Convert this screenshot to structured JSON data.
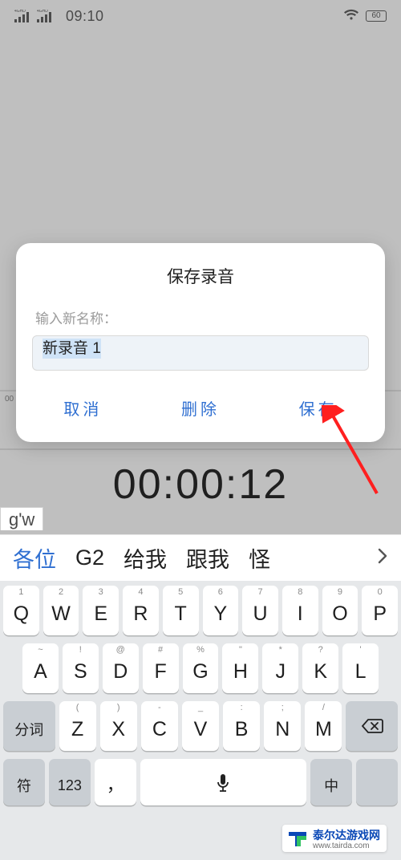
{
  "status_bar": {
    "sim1": "4GHD",
    "sim2": "4GHD",
    "time": "09:10",
    "battery": "60"
  },
  "recorder": {
    "elapsed": "00:00:12",
    "timeline_marker": "00"
  },
  "modal": {
    "title": "保存录音",
    "input_label": "输入新名称：",
    "input_value": "新录音 1",
    "actions": {
      "cancel": "取消",
      "delete": "删除",
      "save": "保存"
    }
  },
  "ime": {
    "composition": "g'w",
    "candidates": [
      "各位",
      "G2",
      "给我",
      "跟我",
      "怪"
    ]
  },
  "keyboard": {
    "row1": [
      {
        "sup": "1",
        "main": "Q"
      },
      {
        "sup": "2",
        "main": "W"
      },
      {
        "sup": "3",
        "main": "E"
      },
      {
        "sup": "4",
        "main": "R"
      },
      {
        "sup": "5",
        "main": "T"
      },
      {
        "sup": "6",
        "main": "Y"
      },
      {
        "sup": "7",
        "main": "U"
      },
      {
        "sup": "8",
        "main": "I"
      },
      {
        "sup": "9",
        "main": "O"
      },
      {
        "sup": "0",
        "main": "P"
      }
    ],
    "row2": [
      {
        "sup": "~",
        "main": "A"
      },
      {
        "sup": "!",
        "main": "S"
      },
      {
        "sup": "@",
        "main": "D"
      },
      {
        "sup": "#",
        "main": "F"
      },
      {
        "sup": "%",
        "main": "G"
      },
      {
        "sup": "\"",
        "main": "H"
      },
      {
        "sup": "*",
        "main": "J"
      },
      {
        "sup": "?",
        "main": "K"
      },
      {
        "sup": "'",
        "main": "L"
      }
    ],
    "row3_fn_left": "分词",
    "row3": [
      {
        "sup": "(",
        "main": "Z"
      },
      {
        "sup": ")",
        "main": "X"
      },
      {
        "sup": "-",
        "main": "C"
      },
      {
        "sup": "_",
        "main": "V"
      },
      {
        "sup": ":",
        "main": "B"
      },
      {
        "sup": ";",
        "main": "N"
      },
      {
        "sup": "/",
        "main": "M"
      }
    ],
    "row4": {
      "sym": "符",
      "num": "123",
      "comma": "，",
      "lang": "中"
    }
  },
  "watermark": {
    "name": "泰尔达游戏网",
    "url": "www.tairda.com"
  },
  "colors": {
    "accent": "#2f6fd1",
    "arrow": "#ff1f1f"
  }
}
